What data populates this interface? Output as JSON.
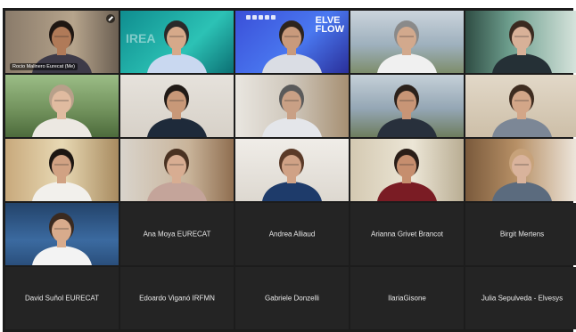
{
  "meeting": {
    "participants": [
      {
        "name": "Rocio Malinero Eurecat (Me)",
        "video": true,
        "scene": "office-f1",
        "name_tag": true,
        "muted": true
      },
      {
        "name": "",
        "video": true,
        "scene": "teal-logo"
      },
      {
        "name": "",
        "video": true,
        "scene": "elveflow"
      },
      {
        "name": "",
        "video": true,
        "scene": "mountain-headset"
      },
      {
        "name": "",
        "video": true,
        "scene": "mint-room"
      },
      {
        "name": "",
        "video": true,
        "scene": "trees"
      },
      {
        "name": "",
        "video": true,
        "scene": "white-wall-glasses"
      },
      {
        "name": "",
        "video": true,
        "scene": "office-shelf"
      },
      {
        "name": "",
        "video": true,
        "scene": "mountain-beard"
      },
      {
        "name": "",
        "video": true,
        "scene": "beige-wall"
      },
      {
        "name": "",
        "video": true,
        "scene": "yellow-light"
      },
      {
        "name": "",
        "video": true,
        "scene": "wood-room"
      },
      {
        "name": "",
        "video": true,
        "scene": "desk-woman"
      },
      {
        "name": "",
        "video": true,
        "scene": "chair-man"
      },
      {
        "name": "",
        "video": true,
        "scene": "bookshelf"
      },
      {
        "name": "",
        "video": true,
        "scene": "plant-blue",
        "active": true
      },
      {
        "name": "Ana Moya EURECAT",
        "video": false
      },
      {
        "name": "Andrea Alliaud",
        "video": false
      },
      {
        "name": "Arianna Grivet Brancot",
        "video": false
      },
      {
        "name": "Birgit Mertens",
        "video": false
      },
      {
        "name": "David Suñol EURECAT",
        "video": false
      },
      {
        "name": "Edoardo Viganó IRFMN",
        "video": false
      },
      {
        "name": "Gabriele Donzelli",
        "video": false
      },
      {
        "name": "IlariaGisone",
        "video": false
      },
      {
        "name": "Julia Sepulveda - Elvesys",
        "video": false
      }
    ],
    "overlays": {
      "elveflow_logo": "ELVE\nFLOW",
      "teal_logo": "IREA"
    }
  }
}
